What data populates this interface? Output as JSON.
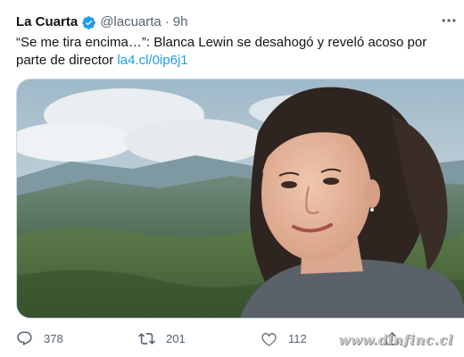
{
  "tweet": {
    "author_name": "La Cuarta",
    "handle": "@lacuarta",
    "separator": "·",
    "time": "9h",
    "text_before_link": "“Se me tira encima…”: Blanca Lewin se desahogó y reveló acoso por parte de director ",
    "link_text": "la4.cl/0ip6j1",
    "verified_icon": "verified-badge-icon",
    "more_icon": "more-options-icon"
  },
  "actions": {
    "replies": "378",
    "retweets": "201",
    "likes": "112"
  },
  "watermark": "www.dinfinc.cl",
  "colors": {
    "link": "#1d9bf0",
    "secondary_text": "#536471",
    "primary_text": "#0f1419",
    "border": "#cfd9de"
  }
}
